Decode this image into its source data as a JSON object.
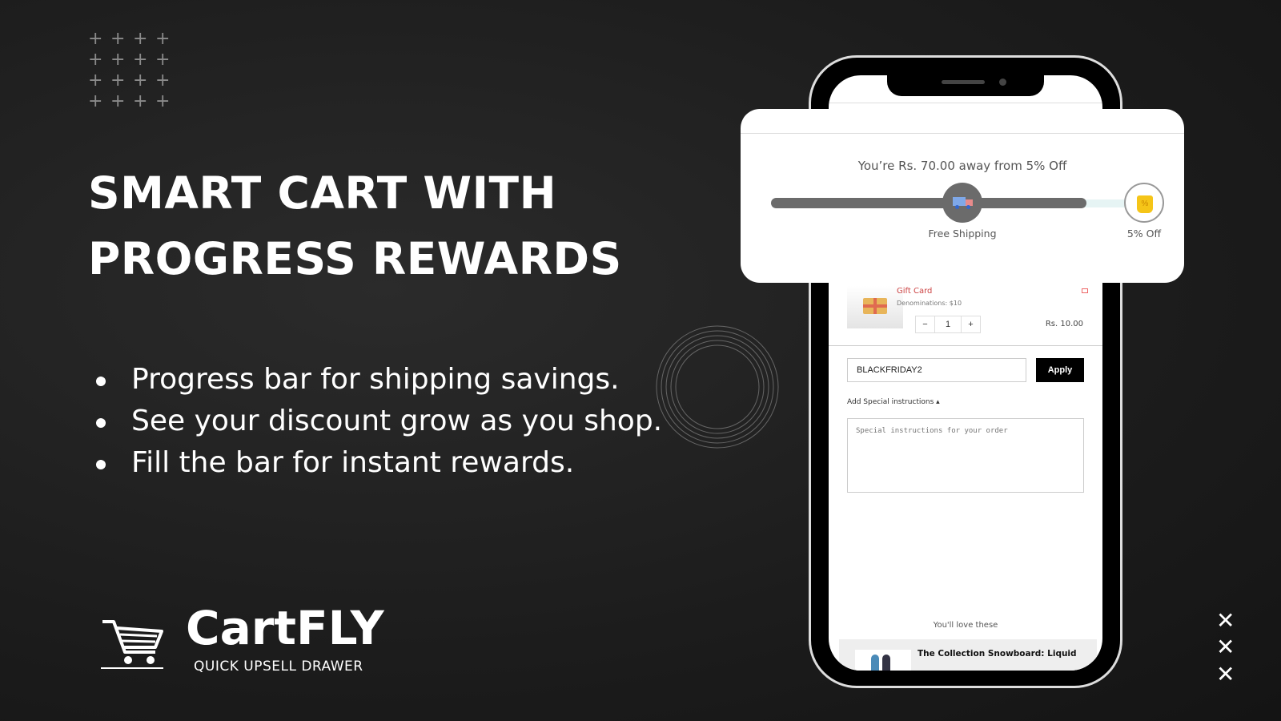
{
  "hero": {
    "title_line1": "SMART CART WITH",
    "title_line2": "PROGRESS REWARDS",
    "bullets": [
      "Progress bar for shipping savings.",
      "See your discount grow as you shop.",
      "Fill the bar for instant rewards."
    ]
  },
  "brand": {
    "name": "CartFLY",
    "tagline": "QUICK UPSELL DRAWER",
    "logo_icon": "shopping-cart-icon"
  },
  "progress": {
    "message": "You’re Rs. 70.00 away from 5% Off",
    "fill_percent": 92,
    "milestones": [
      {
        "label": "Free Shipping",
        "icon": "free-truck-icon"
      },
      {
        "label": "5% Off",
        "icon": "discount-tag-icon"
      }
    ],
    "fill_color": "#6b6b6b",
    "track_color": "#e6f4f4"
  },
  "cart": {
    "item": {
      "name": "Gift Card",
      "variant": "Denominations: $10",
      "quantity": "1",
      "price": "Rs. 10.00"
    },
    "discount": {
      "value": "BLACKFRIDAY2",
      "apply_label": "Apply"
    },
    "instructions": {
      "toggle_label": "Add Special instructions",
      "placeholder": "Special instructions for your order"
    },
    "upsell": {
      "heading": "You'll love these",
      "product": "The Collection Snowboard: Liquid"
    }
  }
}
